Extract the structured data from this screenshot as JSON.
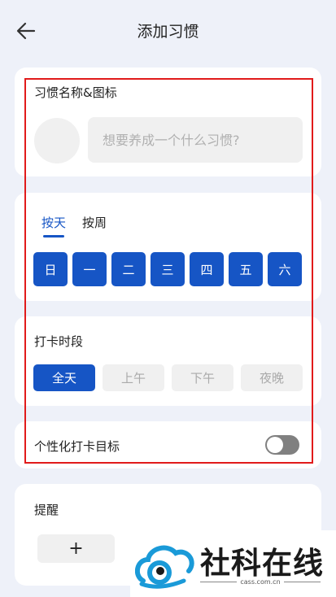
{
  "header": {
    "title": "添加习惯",
    "back_icon": "arrow-left-icon"
  },
  "name_section": {
    "label": "习惯名称&图标",
    "input_placeholder": "想要养成一个什么习惯?"
  },
  "frequency_section": {
    "tabs": [
      {
        "label": "按天",
        "active": true
      },
      {
        "label": "按周",
        "active": false
      }
    ],
    "days": [
      "日",
      "一",
      "二",
      "三",
      "四",
      "五",
      "六"
    ]
  },
  "period_section": {
    "label": "打卡时段",
    "options": [
      {
        "label": "全天",
        "active": true
      },
      {
        "label": "上午",
        "active": false
      },
      {
        "label": "下午",
        "active": false
      },
      {
        "label": "夜晚",
        "active": false
      }
    ]
  },
  "goal_section": {
    "label": "个性化打卡目标",
    "toggle_on": false
  },
  "reminder_section": {
    "label": "提醒",
    "add_label": "+"
  },
  "watermark": {
    "brand": "社科在线",
    "domain": "cass.com.cn"
  },
  "colors": {
    "accent": "#1655c5",
    "background": "#eef1f9",
    "highlight_box": "#e11b1b"
  }
}
